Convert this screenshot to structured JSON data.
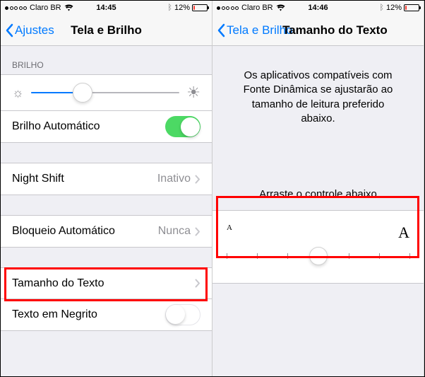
{
  "left": {
    "status": {
      "carrier": "Claro BR",
      "time": "14:45",
      "battery": "12%"
    },
    "nav": {
      "back": "Ajustes",
      "title": "Tela e Brilho"
    },
    "section_brightness": "BRILHO",
    "auto_brightness": "Brilho Automático",
    "night_shift": {
      "label": "Night Shift",
      "value": "Inativo"
    },
    "auto_lock": {
      "label": "Bloqueio Automático",
      "value": "Nunca"
    },
    "text_size": "Tamanho do Texto",
    "bold_text": "Texto em Negrito",
    "brightness_value": 0.35,
    "auto_brightness_on": true,
    "bold_text_on": false
  },
  "right": {
    "status": {
      "carrier": "Claro BR",
      "time": "14:46",
      "battery": "12%"
    },
    "nav": {
      "back": "Tela e Brilho",
      "title": "Tamanho do Texto"
    },
    "description": "Os aplicativos compatíveis com Fonte Dinâmica se ajustarão ao tamanho de leitura preferido abaixo.",
    "instruction": "Arraste o controle abaixo",
    "small_label": "A",
    "large_label": "A",
    "text_size_step": 3,
    "text_size_steps": 7
  }
}
